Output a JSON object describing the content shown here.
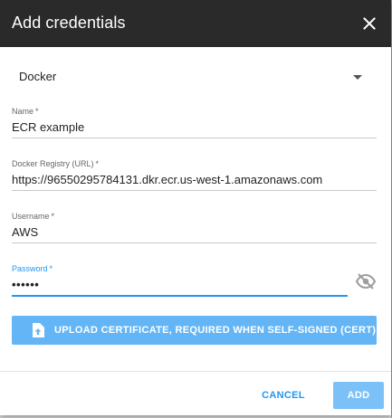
{
  "dialog": {
    "title": "Add credentials",
    "close_icon": "close-icon"
  },
  "credential_type": {
    "selected": "Docker",
    "icon": "chevron-down-icon"
  },
  "fields": {
    "name": {
      "label": "Name",
      "required_mark": "*",
      "value": "ECR example"
    },
    "registry": {
      "label": "Docker Registry (URL)",
      "required_mark": "*",
      "value": "https://96550295784131.dkr.ecr.us-west-1.amazonaws.com"
    },
    "username": {
      "label": "Username",
      "required_mark": "*",
      "value": "AWS"
    },
    "password": {
      "label": "Password",
      "required_mark": "*",
      "value": "••••••",
      "visibility_icon": "eye-off-icon"
    }
  },
  "upload": {
    "label": "UPLOAD CERTIFICATE, REQUIRED WHEN SELF-SIGNED (CERT)",
    "icon": "file-upload-icon"
  },
  "footer": {
    "cancel_label": "CANCEL",
    "add_label": "ADD"
  },
  "colors": {
    "header_bg": "#2a2a2a",
    "accent": "#2196f3",
    "button_light": "#64b5f6"
  }
}
